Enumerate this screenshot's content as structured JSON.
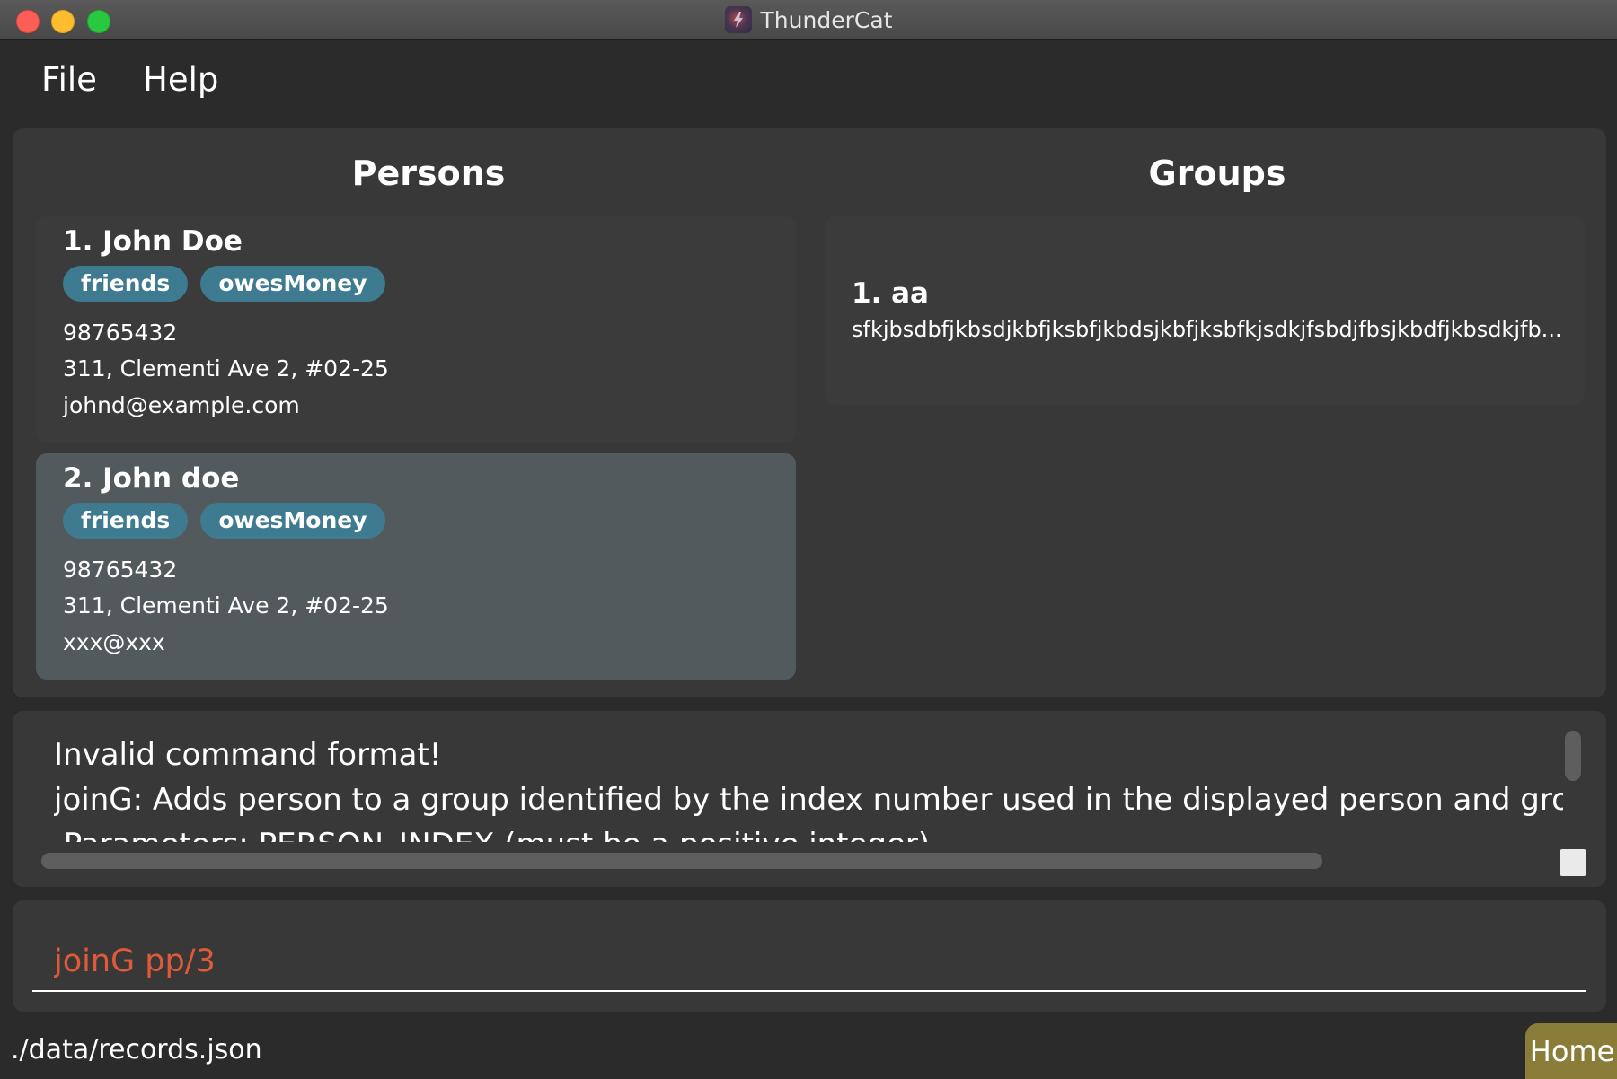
{
  "window": {
    "title": "ThunderCat"
  },
  "menu": {
    "file": "File",
    "help": "Help"
  },
  "persons": {
    "title": "Persons",
    "items": [
      {
        "name": "1.  John Doe",
        "tags": [
          "friends",
          "owesMoney"
        ],
        "phone": "98765432",
        "address": "311, Clementi Ave 2, #02-25",
        "email": "johnd@example.com"
      },
      {
        "name": "2.  John doe",
        "tags": [
          "friends",
          "owesMoney"
        ],
        "phone": "98765432",
        "address": "311, Clementi Ave 2, #02-25",
        "email": "xxx@xxx"
      }
    ]
  },
  "groups": {
    "title": "Groups",
    "items": [
      {
        "name": "1.  aa",
        "description": "sfkjbsdbfjkbsdjkbfjksbfjkbdsjkbfjksbfkjsdkjfsbdjfbsjkbdfjkbsdkjfb..."
      }
    ]
  },
  "result": {
    "line1": "Invalid command format!",
    "line2": "joinG: Adds person to a group identified by the index number used in the displayed person and group lists ir",
    "line3": " Parameters: PERSON_INDEX (must be a positive integer)"
  },
  "command": {
    "value": "joinG pp/3"
  },
  "status": {
    "path": "./data/records.json",
    "home": "Home"
  },
  "colors": {
    "tag": "#3e7b91",
    "command_error": "#e05a3a",
    "home_button": "#8a7d3a"
  }
}
